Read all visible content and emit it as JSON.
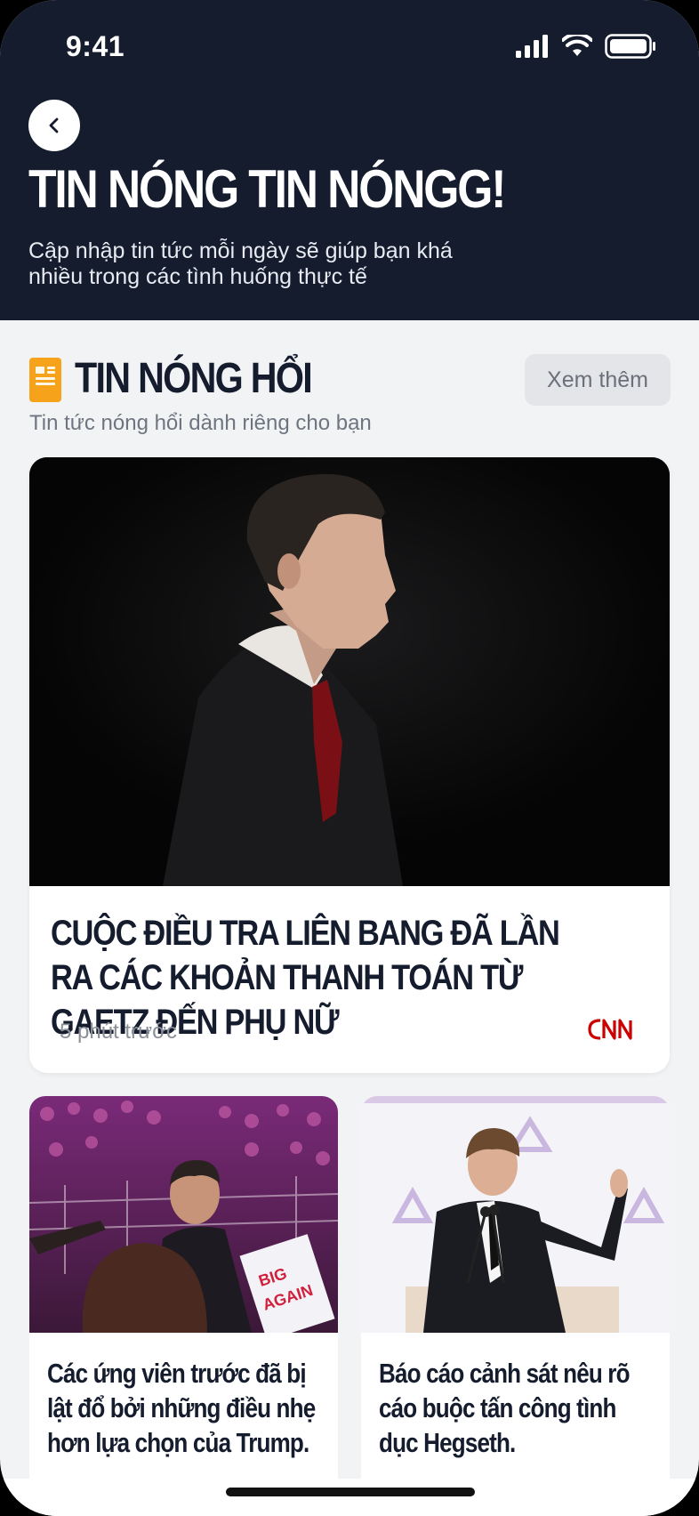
{
  "status": {
    "time": "9:41"
  },
  "header": {
    "title": "TIN NÓNG TIN NÓNGG!",
    "subtitle": "Cập nhập tin tức mỗi ngày sẽ giúp bạn khá nhiều trong các tình huống thực tế"
  },
  "section": {
    "title": "TIN NÓNG HỔI",
    "subtitle": "Tin tức nóng hổi dành riêng cho bạn",
    "more_label": "Xem thêm"
  },
  "featured": {
    "title": "CUỘC ĐIỀU TRA LIÊN BANG ĐÃ LẦN RA CÁC KHOẢN THANH TOÁN TỪ GAETZ ĐẾN PHỤ NỮ",
    "time": "5 phút trước",
    "source": "CNN"
  },
  "articles": [
    {
      "title": "Các ứng viên trước đã bị lật đổ bởi những điều nhẹ hơn lựa chọn của Trump."
    },
    {
      "title": "Báo cáo cảnh sát nêu rõ cáo buộc tấn công tình dục Hegseth."
    }
  ],
  "colors": {
    "header_bg": "#141c2e",
    "accent": "#f7a21b",
    "cnn_red": "#cc0000"
  }
}
